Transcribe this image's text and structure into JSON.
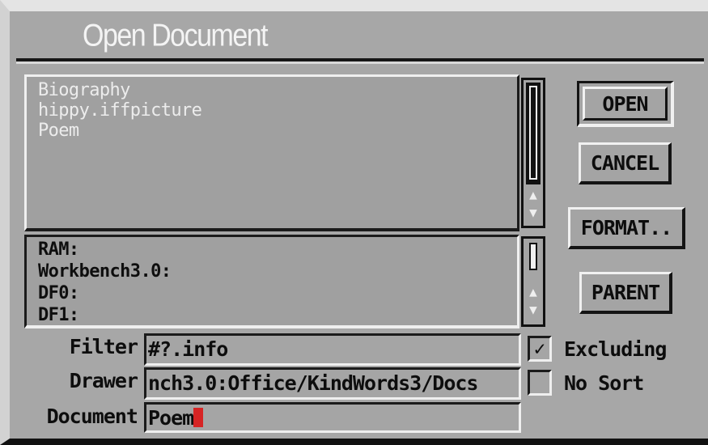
{
  "dialog": {
    "title": "Open Document"
  },
  "file_list": [
    "Biography",
    "hippy.iffpicture",
    "Poem"
  ],
  "volume_list": [
    "RAM:",
    "Workbench3.0:",
    "DF0:",
    "DF1:"
  ],
  "buttons": {
    "open": "OPEN",
    "cancel": "CANCEL",
    "format": "FORMAT..",
    "parent": "PARENT"
  },
  "fields": {
    "filter": {
      "label": "Filter",
      "value": "#?.info"
    },
    "drawer": {
      "label": "Drawer",
      "value": "nch3.0:Office/KindWords3/Docs"
    },
    "document": {
      "label": "Document",
      "value": "Poem"
    }
  },
  "checkboxes": {
    "excluding": {
      "label": "Excluding",
      "checked": true,
      "mark": "✓"
    },
    "no_sort": {
      "label": "No Sort",
      "checked": false,
      "mark": ""
    }
  },
  "icons": {
    "scroll_up": "▲",
    "scroll_down": "▼"
  },
  "colors": {
    "window": "#a7a7a7",
    "highlight": "#efefef",
    "shadow": "#1b1b1b",
    "cursor": "#d62424"
  }
}
